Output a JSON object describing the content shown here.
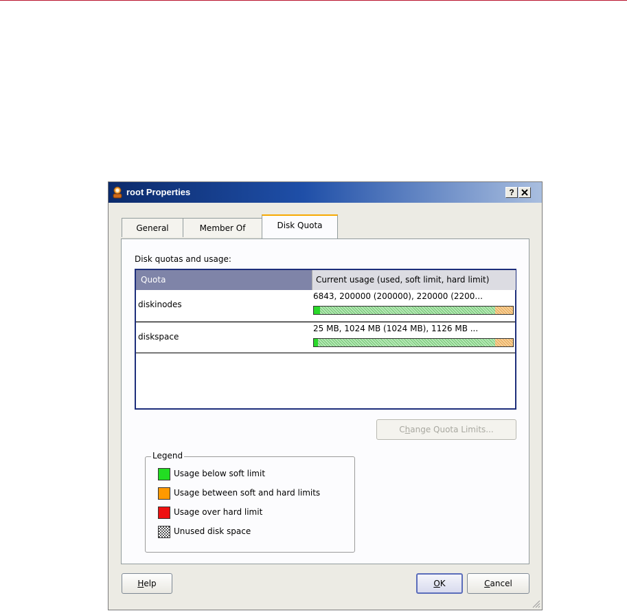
{
  "window": {
    "title": "root Properties",
    "help_button": "?",
    "close_button": "X"
  },
  "tabs": [
    {
      "label": "General"
    },
    {
      "label": "Member Of"
    },
    {
      "label": "Disk Quota"
    }
  ],
  "active_tab": "Disk Quota",
  "panel": {
    "section_label": "Disk quotas and usage:",
    "columns": [
      "Quota",
      "Current usage (used, soft limit, hard limit)"
    ],
    "rows": [
      {
        "name": "diskinodes",
        "usage": "6843, 200000 (200000), 220000 (2200...",
        "used_fraction": 0.031,
        "soft_fraction": 0.909
      },
      {
        "name": "diskspace",
        "usage": "25 MB, 1024 MB (1024 MB), 1126 MB ...",
        "used_fraction": 0.022,
        "soft_fraction": 0.909
      }
    ],
    "change_button": "Change Quota Limits...",
    "legend": {
      "title": "Legend",
      "items": [
        {
          "label": "Usage below soft limit",
          "color": "#22dd22"
        },
        {
          "label": "Usage between soft and hard limits",
          "color": "#ff9900"
        },
        {
          "label": "Usage over hard limit",
          "color": "#ee1111"
        },
        {
          "label": "Unused disk space",
          "color": "checker"
        }
      ]
    }
  },
  "footer": {
    "help": "Help",
    "ok": "OK",
    "cancel": "Cancel"
  },
  "colors": {
    "titlebar_start": "#0b2a6b",
    "titlebar_end": "#a9bedf",
    "list_border": "#1c2d7a",
    "header_selected": "#7f84a8",
    "dialog_bg": "#ecebe4"
  }
}
